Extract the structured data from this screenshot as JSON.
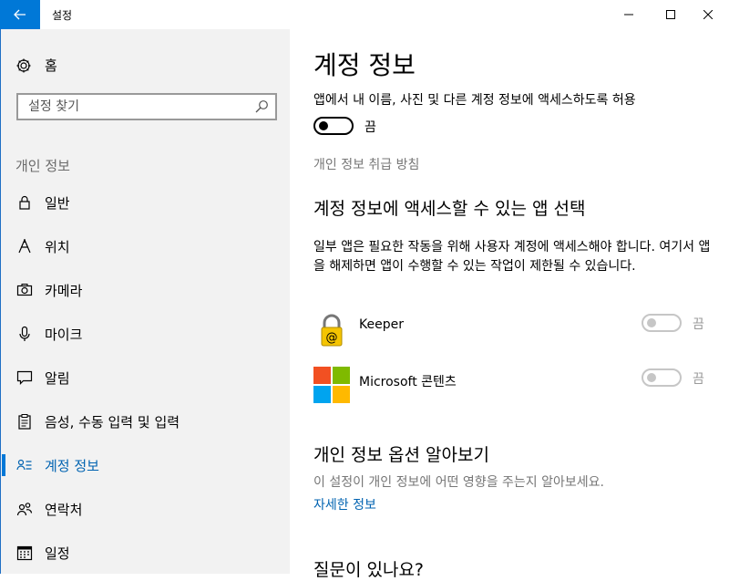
{
  "window": {
    "title": "설정"
  },
  "sidebar": {
    "home_label": "홈",
    "search_placeholder": "설정 찾기",
    "section_title": "개인 정보",
    "items": [
      {
        "label": "일반",
        "icon": "lock-icon"
      },
      {
        "label": "위치",
        "icon": "location-icon"
      },
      {
        "label": "카메라",
        "icon": "camera-icon"
      },
      {
        "label": "마이크",
        "icon": "microphone-icon"
      },
      {
        "label": "알림",
        "icon": "notification-icon"
      },
      {
        "label": "음성, 수동 입력 및 입력",
        "icon": "clipboard-icon"
      },
      {
        "label": "계정 정보",
        "icon": "account-info-icon",
        "selected": true
      },
      {
        "label": "연락처",
        "icon": "contacts-icon"
      },
      {
        "label": "일정",
        "icon": "calendar-icon"
      }
    ]
  },
  "main": {
    "title": "계정 정보",
    "allow_desc": "앱에서 내 이름, 사진 및 다른 계정 정보에 액세스하도록 허용",
    "allow_toggle_label": "끔",
    "privacy_link": "개인 정보 취급 방침",
    "choose_heading": "계정 정보에 액세스할 수 있는 앱 선택",
    "choose_desc": "일부 앱은 필요한 작동을 위해 사용자 계정에 액세스해야 합니다. 여기서 앱을 해제하면 앱이 수행할 수 있는 작업이 제한될 수 있습니다.",
    "apps": [
      {
        "name": "Keeper",
        "toggle_label": "끔"
      },
      {
        "name": "Microsoft 콘텐츠",
        "toggle_label": "끔"
      }
    ],
    "learn_heading": "개인 정보 옵션 알아보기",
    "learn_desc": "이 설정이 개인 정보에 어떤 영향을 주는지 알아보세요.",
    "learn_link": "자세한 정보",
    "question_heading": "질문이 있나요?"
  },
  "colors": {
    "accent": "#0078d7",
    "link": "#0063b1",
    "sidebar_bg": "#f2f2f2"
  }
}
